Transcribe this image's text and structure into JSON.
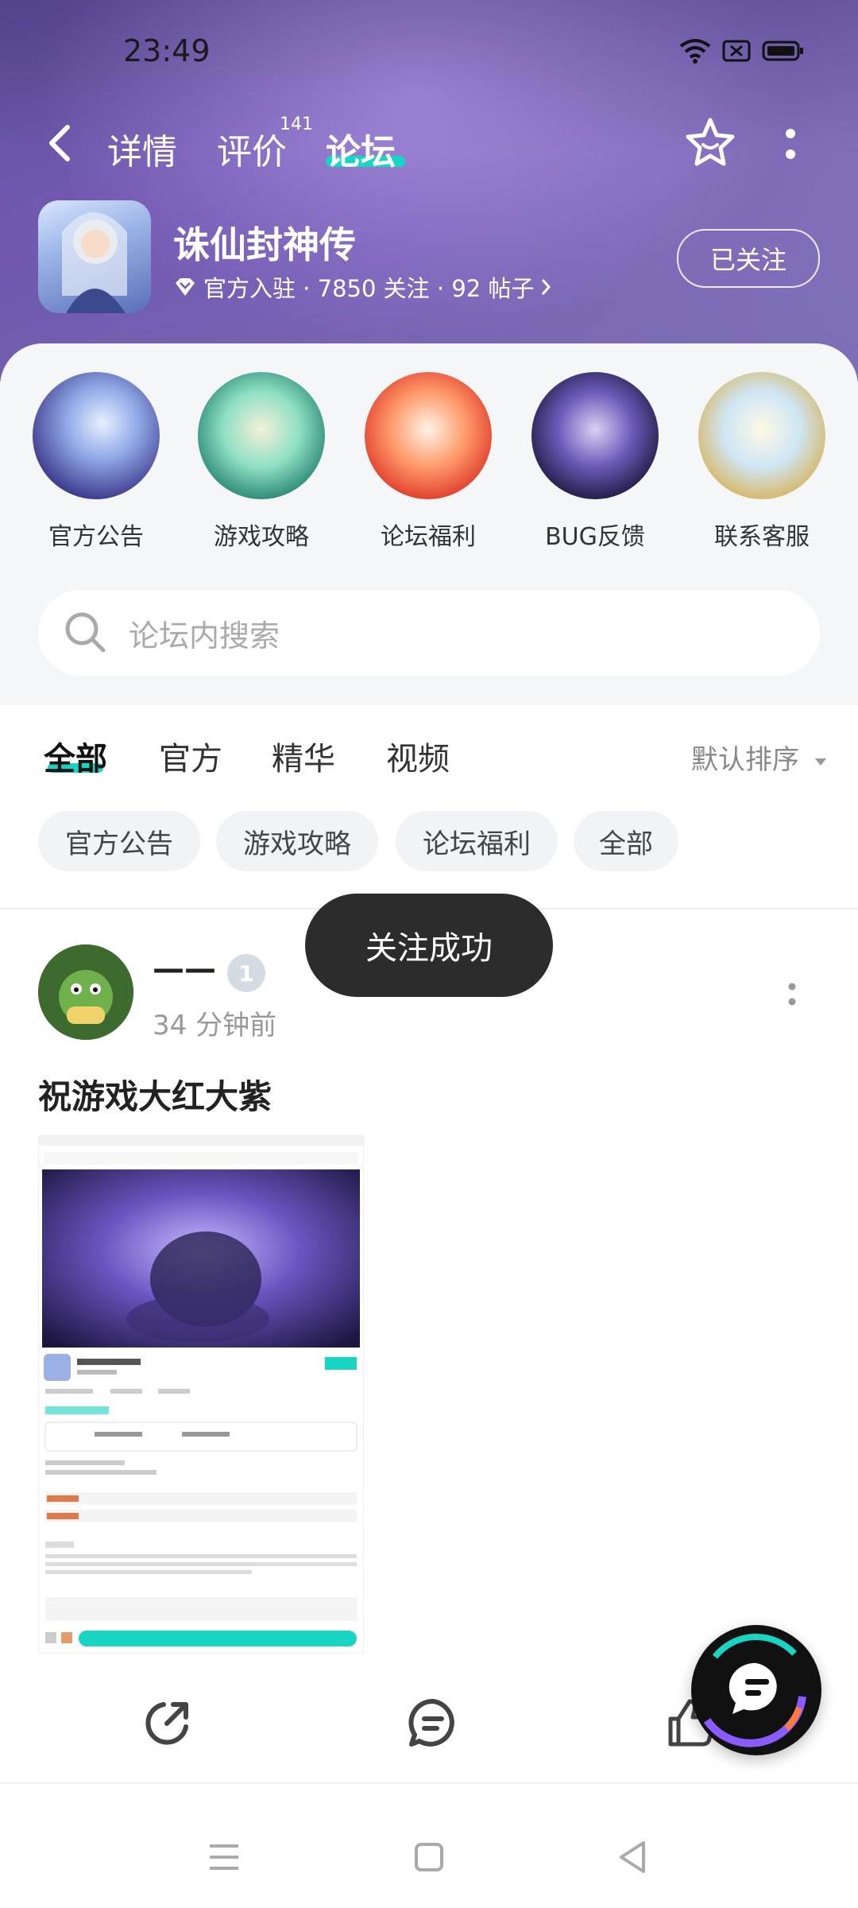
{
  "status_bar": {
    "time": "23:49"
  },
  "header": {
    "tabs": [
      {
        "label": "详情",
        "active": false
      },
      {
        "label": "评价",
        "active": false,
        "badge": "141"
      },
      {
        "label": "论坛",
        "active": true
      }
    ]
  },
  "game": {
    "name": "诛仙封神传",
    "meta": "官方入驻 · 7850 关注 · 92 帖子",
    "follow_label": "已关注"
  },
  "categories": [
    {
      "label": "官方公告"
    },
    {
      "label": "游戏攻略"
    },
    {
      "label": "论坛福利"
    },
    {
      "label": "BUG反馈"
    },
    {
      "label": "联系客服"
    }
  ],
  "search": {
    "placeholder": "论坛内搜索"
  },
  "filter_tabs": [
    {
      "label": "全部",
      "active": true
    },
    {
      "label": "官方",
      "active": false
    },
    {
      "label": "精华",
      "active": false
    },
    {
      "label": "视频",
      "active": false
    }
  ],
  "sort_label": "默认排序",
  "chips": [
    "官方公告",
    "游戏攻略",
    "论坛福利",
    "全部"
  ],
  "post": {
    "username": "——",
    "level": "1",
    "time": "34 分钟前",
    "title": "祝游戏大红大紫"
  },
  "toast": "关注成功",
  "colors": {
    "accent": "#18d4c2",
    "header_bg": "#6d5aa8"
  }
}
